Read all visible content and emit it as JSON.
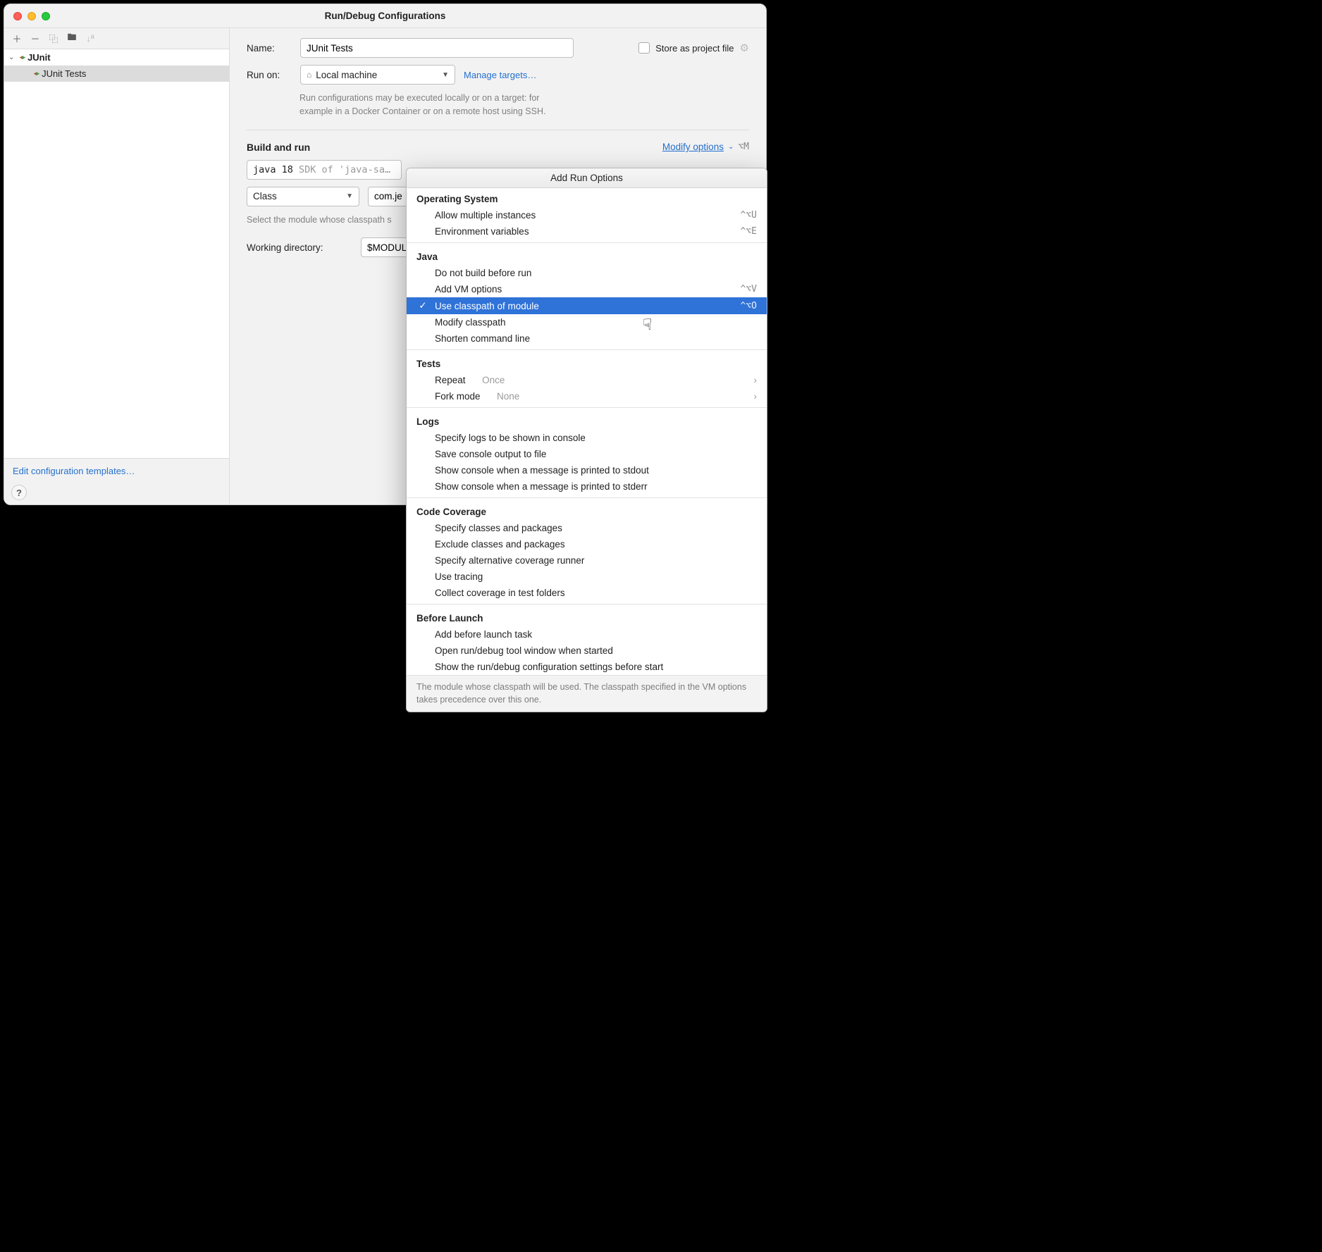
{
  "window": {
    "title": "Run/Debug Configurations"
  },
  "sidebar": {
    "root": {
      "label": "JUnit"
    },
    "child": {
      "label": "JUnit Tests"
    },
    "edit_templates": "Edit configuration templates…"
  },
  "form": {
    "name_label": "Name:",
    "name_value": "JUnit Tests",
    "store_label": "Store as project file",
    "runon_label": "Run on:",
    "runon_value": "Local machine",
    "manage_targets": "Manage targets…",
    "runon_hint": "Run configurations may be executed locally or on a target: for example in a Docker Container or on a remote host using SSH.",
    "build_and_run": "Build and run",
    "modify_options": "Modify options",
    "modify_kbd": "⌥M",
    "java_sdk_pre": "java 18 ",
    "java_sdk_post": "SDK of 'java-sa…",
    "type_value": "Class",
    "class_value": "com.je",
    "classpath_hint": "Select the module whose classpath s",
    "workdir_label": "Working directory:",
    "workdir_value": "$MODULE"
  },
  "popup": {
    "title": "Add Run Options",
    "footnote": "The module whose classpath will be used. The classpath specified in the VM options takes precedence over this one.",
    "sections": [
      {
        "title": "Operating System",
        "items": [
          {
            "label": "Allow multiple instances",
            "kbd": "^⌥U"
          },
          {
            "label": "Environment variables",
            "kbd": "^⌥E"
          }
        ]
      },
      {
        "title": "Java",
        "items": [
          {
            "label": "Do not build before run"
          },
          {
            "label": "Add VM options",
            "kbd": "^⌥V"
          },
          {
            "label": "Use classpath of module",
            "kbd": "^⌥O",
            "checked": true,
            "highlighted": true
          },
          {
            "label": "Modify classpath"
          },
          {
            "label": "Shorten command line"
          }
        ]
      },
      {
        "title": "Tests",
        "items": [
          {
            "label": "Repeat",
            "secondary": "Once",
            "submenu": true
          },
          {
            "label": "Fork mode",
            "secondary": "None",
            "submenu": true
          }
        ]
      },
      {
        "title": "Logs",
        "items": [
          {
            "label": "Specify logs to be shown in console"
          },
          {
            "label": "Save console output to file"
          },
          {
            "label": "Show console when a message is printed to stdout"
          },
          {
            "label": "Show console when a message is printed to stderr"
          }
        ]
      },
      {
        "title": "Code Coverage",
        "items": [
          {
            "label": "Specify classes and packages"
          },
          {
            "label": "Exclude classes and packages"
          },
          {
            "label": "Specify alternative coverage runner"
          },
          {
            "label": "Use tracing"
          },
          {
            "label": "Collect coverage in test folders"
          }
        ]
      },
      {
        "title": "Before Launch",
        "items": [
          {
            "label": "Add before launch task"
          },
          {
            "label": "Open run/debug tool window when started"
          },
          {
            "label": "Show the run/debug configuration settings before start"
          }
        ]
      }
    ]
  }
}
